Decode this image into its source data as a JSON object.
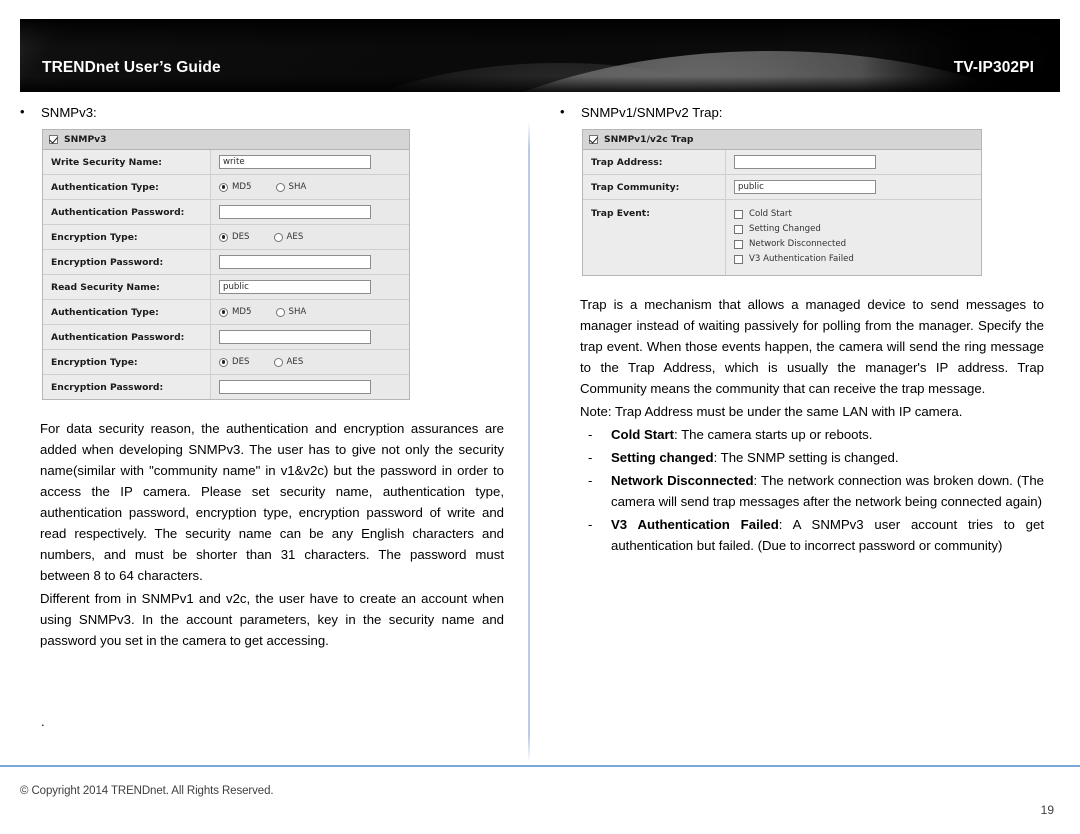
{
  "header": {
    "title": "TRENDnet User’s Guide",
    "model": "TV-IP302PI"
  },
  "left_column": {
    "bullet_label": "SNMPv3:",
    "panel": {
      "header": {
        "label": "SNMPv3",
        "checkbox_checked": true
      },
      "rows": [
        {
          "kind": "text",
          "label": "Write Security Name:",
          "value": "write"
        },
        {
          "kind": "radio",
          "label": "Authentication Type:",
          "options": [
            "MD5",
            "SHA"
          ],
          "selected": "MD5"
        },
        {
          "kind": "text",
          "label": "Authentication Password:",
          "value": ""
        },
        {
          "kind": "radio",
          "label": "Encryption Type:",
          "options": [
            "DES",
            "AES"
          ],
          "selected": "DES"
        },
        {
          "kind": "text",
          "label": "Encryption Password:",
          "value": ""
        },
        {
          "kind": "text",
          "label": "Read Security Name:",
          "value": "public"
        },
        {
          "kind": "radio",
          "label": "Authentication Type:",
          "options": [
            "MD5",
            "SHA"
          ],
          "selected": "MD5"
        },
        {
          "kind": "text",
          "label": "Authentication Password:",
          "value": ""
        },
        {
          "kind": "radio",
          "label": "Encryption Type:",
          "options": [
            "DES",
            "AES"
          ],
          "selected": "DES"
        },
        {
          "kind": "text",
          "label": "Encryption Password:",
          "value": ""
        }
      ]
    },
    "paragraph_1": "For data security reason, the authentication and encryption assurances are added when developing SNMPv3. The user has to give not only the security name(similar with \"community name\" in v1&v2c) but the password in order to access the IP camera. Please set security name, authentication type, authentication password, encryption type, encryption password of write and read respectively. The security name can be any English characters and numbers, and must be shorter than 31 characters. The password must between 8 to 64 characters.",
    "paragraph_2": "Different from in SNMPv1 and v2c, the user have to create an account when using SNMPv3. In the account parameters, key in the security name and password you set in the camera to get accessing.",
    "stray_mark": "."
  },
  "right_column": {
    "bullet_label": "SNMPv1/SNMPv2 Trap:",
    "panel": {
      "header": {
        "label": "SNMPv1/v2c Trap",
        "checkbox_checked": true
      },
      "trap_address": {
        "label": "Trap Address:",
        "value": ""
      },
      "trap_community": {
        "label": "Trap Community:",
        "value": "public"
      },
      "trap_event": {
        "label": "Trap Event:",
        "items": [
          {
            "label": "Cold Start",
            "checked": false
          },
          {
            "label": "Setting Changed",
            "checked": false
          },
          {
            "label": "Network Disconnected",
            "checked": false
          },
          {
            "label": "V3 Authentication Failed",
            "checked": false
          }
        ]
      }
    },
    "paragraph_1": "Trap is a mechanism that allows a managed device to send messages to manager instead of waiting passively for polling from the manager. Specify the trap event. When those events happen, the camera will send the ring message to the Trap Address, which is usually the manager's IP address. Trap Community means the community that can receive the trap message.",
    "note": "Note: Trap Address must be under the same LAN with IP camera.",
    "events": [
      {
        "term": "Cold Start",
        "desc": ": The camera starts up or reboots."
      },
      {
        "term": "Setting changed",
        "desc": ": The SNMP setting is changed."
      },
      {
        "term": "Network Disconnected",
        "desc": ": The network connection was broken down. (The camera will send trap messages after the network being connected again)"
      },
      {
        "term": "V3 Authentication Failed",
        "desc": ": A SNMPv3 user account tries to get authentication but failed. (Due to incorrect password or community)"
      }
    ]
  },
  "footer": {
    "copyright": "© Copyright 2014 TRENDnet.  All Rights Reserved.",
    "page_number": "19"
  },
  "colors": {
    "footer_rule": "#7ba7d7",
    "divider": "#b0c4de",
    "banner": "#050505",
    "panel_label_bg": "#ececec",
    "panel_header_bg": "#d5d5d5"
  }
}
